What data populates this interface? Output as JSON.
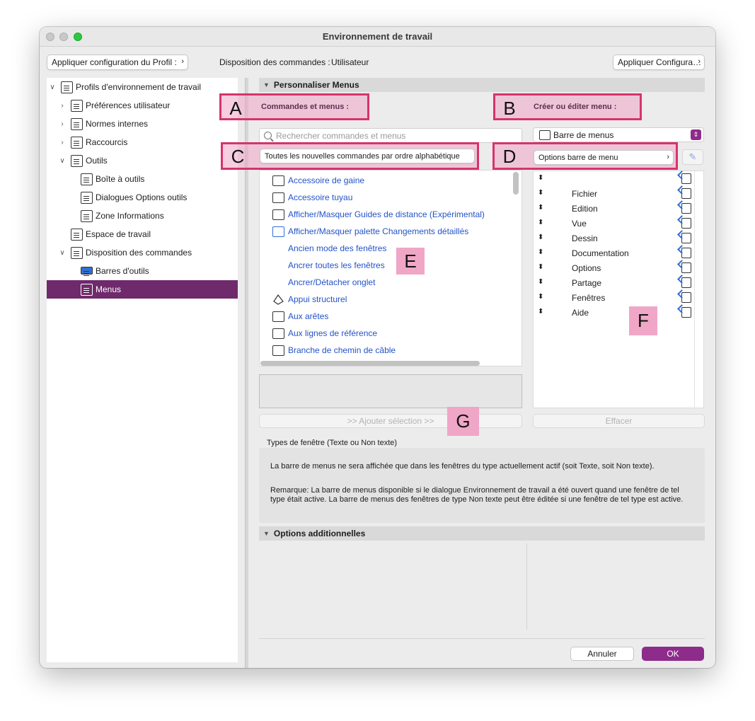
{
  "window": {
    "title": "Environnement de travail"
  },
  "toolbar": {
    "apply_profile": "Appliquer configuration du Profil :",
    "layout_label": "Disposition des commandes :",
    "layout_value": "Utilisateur",
    "apply_config": "Appliquer Configura…"
  },
  "sidebar": {
    "items": [
      {
        "label": "Profils d'environnement de travail",
        "arrow": "∨"
      },
      {
        "label": "Préférences utilisateur",
        "arrow": "›"
      },
      {
        "label": "Normes internes",
        "arrow": "›"
      },
      {
        "label": "Raccourcis",
        "arrow": "›"
      },
      {
        "label": "Outils",
        "arrow": "∨"
      },
      {
        "label": "Boîte à outils",
        "arrow": ""
      },
      {
        "label": "Dialogues Options outils",
        "arrow": ""
      },
      {
        "label": "Zone Informations",
        "arrow": ""
      },
      {
        "label": "Espace de travail",
        "arrow": ""
      },
      {
        "label": "Disposition des commandes",
        "arrow": "∨"
      },
      {
        "label": "Barres d'outils",
        "arrow": ""
      },
      {
        "label": "Menus",
        "arrow": ""
      }
    ]
  },
  "customize": {
    "header": "Personnaliser Menus",
    "commands_label": "Commandes et menus :",
    "create_label": "Créer ou éditer menu :",
    "search_placeholder": "Rechercher commandes et menus",
    "sort_option": "Toutes les nouvelles commandes par ordre alphabétique",
    "menu_select": "Barre de menus",
    "menu_options": "Options barre de menu",
    "add_selection": ">> Ajouter sélection >>",
    "clear": "Effacer"
  },
  "commands": [
    "Accessoire de gaine",
    "Accessoire tuyau",
    "Afficher/Masquer Guides de distance (Expérimental)",
    "Afficher/Masquer palette Changements détaillés",
    "Ancien mode des fenêtres",
    "Ancrer toutes les fenêtres",
    "Ancrer/Détacher onglet",
    "Appui structurel",
    "Aux arêtes",
    "Aux lignes de référence",
    "Branche de chemin de câble"
  ],
  "menu_items": [
    "",
    "Fichier",
    "Edition",
    "Vue",
    "Dessin",
    "Documentation",
    "Options",
    "Partage",
    "Fenêtres",
    "Aide"
  ],
  "info": {
    "label": "Types de fenêtre (Texte ou Non texte)",
    "line1": "La barre de menus ne sera affichée que dans les fenêtres du type actuellement actif (soit Texte, soit Non texte).",
    "line2": "Remarque: La barre de menus disponible si le dialogue Environnement de travail a été ouvert quand une fenêtre de tel type était active. La barre de menus des fenêtres de type Non texte peut être éditée si une fenêtre de tel type est active."
  },
  "additional": {
    "header": "Options additionnelles"
  },
  "footer": {
    "cancel": "Annuler",
    "ok": "OK"
  },
  "annotations": [
    "A",
    "B",
    "C",
    "D",
    "E",
    "F",
    "G"
  ],
  "colors": {
    "accent": "#8d2c8a",
    "selection": "#6f2a6c",
    "link": "#2353c8",
    "annotation": "#f0a6c6",
    "highlight_border": "#d6336c"
  }
}
